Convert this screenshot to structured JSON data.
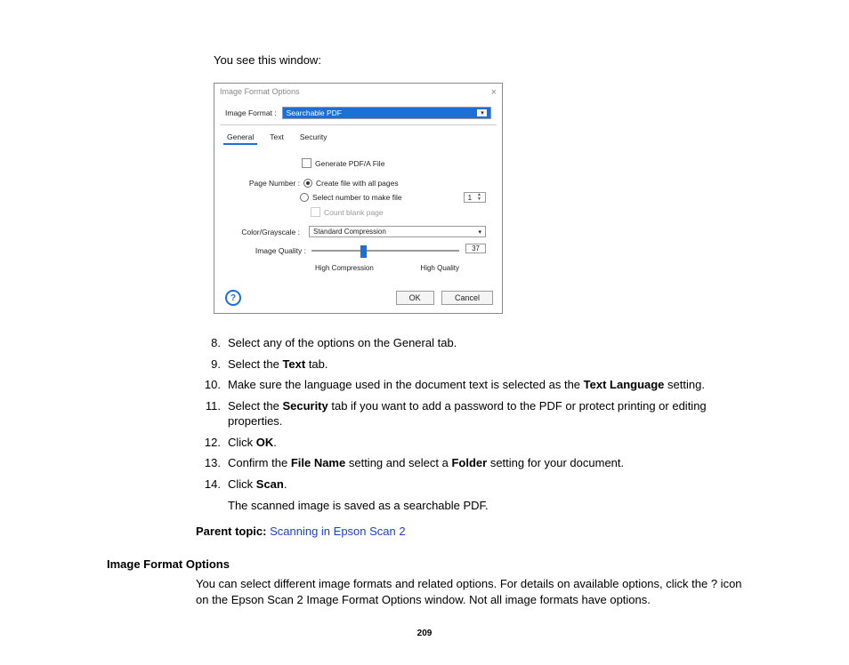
{
  "intro": "You see this window:",
  "dialog": {
    "title": "Image Format Options",
    "close": "×",
    "imageFormatLabel": "Image Format :",
    "imageFormatValue": "Searchable PDF",
    "tabs": {
      "general": "General",
      "text": "Text",
      "security": "Security"
    },
    "generatePdfA": "Generate PDF/A File",
    "pageNumberLabel": "Page Number :",
    "radioAll": "Create file with all pages",
    "radioSel": "Select number to make file",
    "spinValue": "1",
    "countBlank": "Count blank page",
    "colorLabel": "Color/Grayscale :",
    "colorValue": "Standard Compression",
    "qualityLabel": "Image Quality :",
    "qualityValue": "37",
    "highComp": "High Compression",
    "highQual": "High Quality",
    "ok": "OK",
    "cancel": "Cancel",
    "help": "?"
  },
  "steps": {
    "s8n": "8.",
    "s8": "Select any of the options on the General tab.",
    "s9n": "9.",
    "s9a": "Select the ",
    "s9b": "Text",
    "s9c": " tab.",
    "s10n": "10.",
    "s10a": "Make sure the language used in the document text is selected as the ",
    "s10b": "Text Language",
    "s10c": " setting.",
    "s11n": "11.",
    "s11a": "Select the ",
    "s11b": "Security",
    "s11c": " tab if you want to add a password to the PDF or protect printing or editing properties.",
    "s12n": "12.",
    "s12a": "Click ",
    "s12b": "OK",
    "s12c": ".",
    "s13n": "13.",
    "s13a": "Confirm the ",
    "s13b": "File Name",
    "s13c": " setting and select a ",
    "s13d": "Folder",
    "s13e": " setting for your document.",
    "s14n": "14.",
    "s14a": "Click ",
    "s14b": "Scan",
    "s14c": "."
  },
  "afterScan": "The scanned image is saved as a searchable PDF.",
  "parentTopicLabel": "Parent topic:",
  "parentTopicLink": "Scanning in Epson Scan 2",
  "sectionHeading": "Image Format Options",
  "sectionBody": "You can select different image formats and related options. For details on available options, click the ? icon on the Epson Scan 2 Image Format Options window. Not all image formats have options.",
  "pageNumber": "209"
}
